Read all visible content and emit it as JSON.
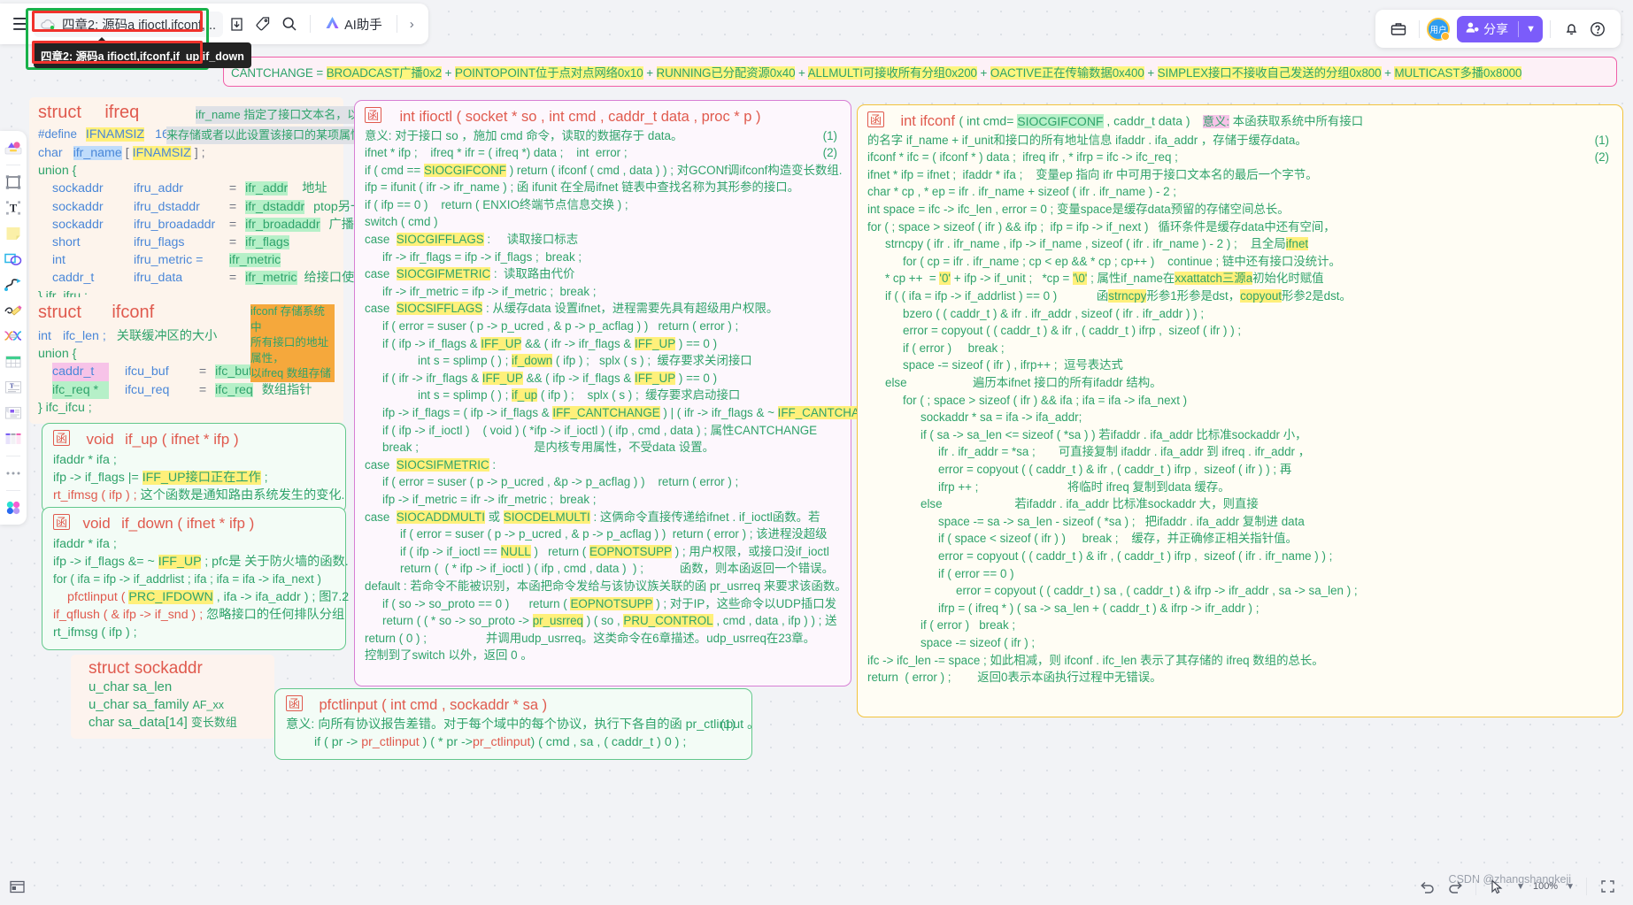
{
  "app": {
    "doc_title": "四章2: 源码a ifioctl,ifconf,...",
    "tooltip": "四章2: 源码a  ifioctl,ifconf,if_up,if_down",
    "ai_assistant": "AI助手",
    "share_label": "分享",
    "avatar_label": "用户",
    "zoom_level": "100%"
  },
  "toolbar_icons": [
    {
      "name": "menu-icon",
      "glyph": "≡"
    },
    {
      "name": "export-icon",
      "glyph": "⇩"
    },
    {
      "name": "tag-icon",
      "glyph": "🏷"
    },
    {
      "name": "search-icon",
      "glyph": "🔍"
    },
    {
      "name": "ai-icon",
      "glyph": "Ⓜ"
    },
    {
      "name": "expand-right-icon",
      "glyph": "›"
    }
  ],
  "topright_icons": [
    {
      "name": "briefcase-icon",
      "glyph": "🧰"
    },
    {
      "name": "bell-icon",
      "glyph": "🔔"
    },
    {
      "name": "help-icon",
      "glyph": "?"
    }
  ],
  "rail_items": [
    {
      "name": "shapes-tool"
    },
    {
      "name": "select-frame-tool"
    },
    {
      "name": "text-tool"
    },
    {
      "name": "sticky-note-tool"
    },
    {
      "name": "shape-tool"
    },
    {
      "name": "connector-tool"
    },
    {
      "name": "pen-tool"
    },
    {
      "name": "curve-tool"
    },
    {
      "name": "table-tool"
    },
    {
      "name": "text-card-tool"
    },
    {
      "name": "card-tool"
    },
    {
      "name": "kanban-tool"
    },
    {
      "name": "more-tools"
    },
    {
      "name": "color-palette-tool"
    }
  ],
  "banner": {
    "prefix": "CANTCHANGE = ",
    "items": [
      {
        "hl": "BROAD",
        "rest": "CAST广播0x2"
      },
      {
        "hl": "POINTO",
        "rest": "POINT位于点对点网络0x10"
      },
      {
        "hl": "RUNNING",
        "rest": "已分配资源0x40"
      },
      {
        "hl": "ALL",
        "rest": "MULTI可接收所有分组0x200"
      },
      {
        "hl": "O",
        "rest": "ACTIVE正在传输数据0x400"
      },
      {
        "hl": "",
        "rest": "SIMPLEX接口不接收自己发送的分组0x800"
      },
      {
        "hl": "MULTI",
        "rest": "CAST多播0x8000"
      }
    ]
  },
  "ifreq": {
    "title_kw": "struct",
    "title_name": "ifreq",
    "note1": "ifr_name 指定了接口文本名，以共用体",
    "note2": "来存储或者以此设置该接口的某项属性",
    "define_kw": "#define",
    "define_name": "IFNAMSIZ",
    "define_val": "16",
    "l_char": "char",
    "l_ifr_name": "ifr_name",
    "l_brk1": "[",
    "l_ifnamsiz": "IFNAMSIZ",
    "l_brk2": "] ;",
    "union_open": "union {",
    "members": [
      {
        "type": "sockaddr",
        "field": "ifru_addr",
        "eq": "=",
        "alias": "ifr_addr",
        "cmt": "地址"
      },
      {
        "type": "sockaddr",
        "field": "ifru_dstaddr",
        "eq": "=",
        "alias": "ifr_dstaddr",
        "cmt": "ptop另一端地址"
      },
      {
        "type": "sockaddr",
        "field": "ifru_broadaddr",
        "eq": "=",
        "alias": "ifr_broadaddr",
        "cmt": "广播地址"
      },
      {
        "type": "short",
        "field": "ifru_flags",
        "eq": "=",
        "alias": "ifr_flags",
        "cmt": ""
      },
      {
        "type": "int",
        "field": "ifru_metric =",
        "eq": "",
        "alias": "ifr_metric",
        "cmt": ""
      },
      {
        "type": "caddr_t",
        "field": "ifru_data",
        "eq": "=",
        "alias": "ifr_metric",
        "cmt": "给接口使用"
      }
    ],
    "union_close": "} ifr_ifru ;"
  },
  "ifconf_struct": {
    "title_kw": "struct",
    "title_name": "ifconf",
    "note": [
      "ifconf 存储系统中",
      "所有接口的地址属性，",
      "以ifreq 数组存储"
    ],
    "line_int": "int",
    "line_iclen": "ifc_len ;",
    "line_cmt": "关联缓冲区的大小",
    "union_open": "union {",
    "members": [
      {
        "type": "caddr_t",
        "field": "ifcu_buf",
        "eq": "=",
        "alias": "ifc_buf",
        "cmt": ""
      },
      {
        "type": "ifc_req *",
        "field": "ifcu_req",
        "eq": "=",
        "alias": "ifc_req",
        "cmt": "数组指针"
      }
    ],
    "union_close": "}  ifc_ifcu ;"
  },
  "if_up": {
    "sig_ret": "void",
    "sig_name": "if_up ( ifnet * ifp )",
    "lines": [
      "ifaddr * ifa ;",
      "ifp -> if_flags |= ",
      "rt_ifmsg ( ifp ) ; 这个函数是通知路由系统发生的变化."
    ],
    "hl_flag": "IFF_UP接口正在工作",
    "semi": " ;"
  },
  "if_down": {
    "sig_ret": "void",
    "sig_name": "if_down ( ifnet * ifp )",
    "l1": "ifaddr * ifa ;",
    "l2a": "ifp -> if_flags &=  ~ ",
    "l2hl": "IFF_UP",
    "l2b": " ; pfc是 关于防火墙的函数.",
    "l3": "for ( ifa = ifp -> if_addrlist ; ifa ; ifa = ifa -> ifa_next )",
    "l4a": "pfctlinput ( ",
    "l4hl": "PRC_IFDOWN",
    "l4b": " , ifa -> ifa_addr ) ; 图7.2",
    "l5": "if_qflush ( & ifp -> if_snd ) ; 忽略接口的任何排队分组",
    "l6": "rt_ifmsg ( ifp ) ;"
  },
  "sockaddr": {
    "title": "struct sockaddr",
    "l1a": "u_char sa_len",
    "l2a": "u_char sa_family",
    "l2b": "AF_xx",
    "l3a": "char sa_data[14]",
    "l3b": "变长数组"
  },
  "ifioctl": {
    "sig": "int  ifioctl ( socket * so , int cmd , caddr_t  data , proc * p )",
    "lines": [
      {
        "t": "意义: 对于接口 so ，施加 cmd 命令，读取的数据存于 data。",
        "n": "(1)"
      },
      {
        "t": "ifnet * ifp ;    ifreq * ifr = ( ifreq *) data ;    int  error ;",
        "n": "(2)"
      },
      {
        "t": "if ( cmd == §SIOCGIFCONF§ ) return ( ifconf ( cmd , data ) ) ; 对GCONf调ifconf构造变长数组.",
        "n": ""
      },
      {
        "t": "ifp = ifunit ( ifr -> ifr_name ) ; 函 ifunit 在全局ifnet 链表中查找名称为其形参的接口。",
        "n": ""
      },
      {
        "t": "if ( ifp == 0 )    return ( ENXIO终端节点信息交换 ) ;",
        "n": ""
      },
      {
        "t": "switch ( cmd )",
        "n": ""
      },
      {
        "t": "case  §SIOCGIFFLAGS§ :     读取接口标志",
        "n": ""
      },
      {
        "t": "    ifr -> ifr_flags = ifp -> if_flags ;  break ;",
        "n": ""
      },
      {
        "t": "case  §SIOCGIFMETRIC§ :  读取路由代价",
        "n": ""
      },
      {
        "t": "    ifr -> ifr_metric = ifp -> if_metric ;  break ;",
        "n": ""
      },
      {
        "t": "case  §SIOCSIFFLAGS§ : 从缓存data 设置ifnet，进程需要先具有超级用户权限。",
        "n": ""
      },
      {
        "t": "    if ( error = suser ( p -> p_ucred , & p -> p_acflag ) )   return ( error ) ;",
        "n": ""
      },
      {
        "t": "    if ( ifp -> if_flags & §IFF_UP§ && ( ifr -> ifr_flags & §IFF_UP§ ) == 0 )",
        "n": ""
      },
      {
        "t": "            int s = splimp ( ) ; §if_down§ ( ifp ) ;   splx ( s ) ;  缓存要求关闭接口",
        "n": ""
      },
      {
        "t": "    if ( ifr -> ifr_flags & §IFF_UP§ && ( ifp -> if_flags & §IFF_UP§ ) == 0 )",
        "n": ""
      },
      {
        "t": "            int s = splimp ( ) ; §if_up§ ( ifp ) ;    splx ( s ) ;  缓存要求启动接口",
        "n": ""
      },
      {
        "t": "    ifp -> if_flags = ( ifp -> if_flags & §IFF_CANTCHANGE§ ) | ( ifr -> ifr_flags & ~ §IFF_CANTCHANGE§ ) ;",
        "n": ""
      },
      {
        "t": "    if ( ifp -> if_ioctl )    ( void ) ( *ifp -> if_ioctl ) ( ifp , cmd , data ) ; 属性CANTCHANGE",
        "n": ""
      },
      {
        "t": "    break ;                                   是内核专用属性，不受data 设置。",
        "n": ""
      },
      {
        "t": "case  §SIOCSIFMETRIC§ :",
        "n": ""
      },
      {
        "t": "    if ( error = suser ( p -> p_ucred , &p -> p_acflag ) )    return ( error ) ;",
        "n": ""
      },
      {
        "t": "    ifp -> if_metric = ifr -> ifr_metric ;  break ;",
        "n": ""
      },
      {
        "t": "case  §SIOCADDMULTI§ 或 §SIOCDELMULTI§ : 这俩命令直接传递给ifnet . if_ioctl函数。若",
        "n": ""
      },
      {
        "t": "        if ( error = suser ( p -> p_ucred , & p -> p_acflag ) )  return ( error ) ; 该进程没超级",
        "n": ""
      },
      {
        "t": "        if ( ifp -> if_ioctl == §NULL§ )   return ( §EOPNOTSUPP§ ) ; 用户权限，或接口没if_ioctl",
        "n": ""
      },
      {
        "t": "        return (  ( * ifp -> if_ioctl ) ( ifp , cmd , data )  ) ;           函数，则本函返回一个错误。",
        "n": ""
      },
      {
        "t": "default : 若命令不能被识别，本函把命令发给与该协议族关联的函 pr_usrreq 来要求该函数。",
        "n": ""
      },
      {
        "t": "    if ( so -> so_proto == 0 )      return ( §EOPNOTSUPP§ ) ; 对于IP，这些命令以UDP插口发",
        "n": ""
      },
      {
        "t": "    return ( ( * so -> so_proto -> §pr_usrreq§ ) ( so , §PRU_CONTROL§ , cmd , data , ifp ) ) ; 送",
        "n": ""
      },
      {
        "t": "return ( 0 ) ;                  并调用udp_usrreq。这类命令在6章描述。udp_usrreq在23章。",
        "n": ""
      },
      {
        "t": "控制到了switch 以外，返回 0 。",
        "n": ""
      }
    ]
  },
  "ifconf_fn": {
    "sig_a": "int  ifconf ",
    "sig_b": "( int  cmd= ",
    "sig_hl": "SIOCGIFCONF",
    "sig_c": " , caddr_t   data )",
    "sig_note_hl": "意义:",
    "sig_note": " 本函获取系统中所有接口",
    "lines": [
      {
        "t": "的名字 if_name + if_unit和接口的所有地址信息 ifaddr . ifa_addr ，存储于缓存data。",
        "n": "(1)"
      },
      {
        "t": "ifconf * ifc = ( ifconf * ) data ;  ifreq ifr , * ifrp = ifc -> ifc_req ;",
        "n": "(2)"
      },
      {
        "t": "ifnet * ifp = ifnet ;  ifaddr * ifa ;    变量ep 指向 ifr 中可用于接口文本名的最后一个字节。",
        "n": ""
      },
      {
        "t": "char * cp , * ep = ifr . ifr_name + sizeof ( ifr . ifr_name ) - 2 ;",
        "n": ""
      },
      {
        "t": "int space = ifc -> ifc_len , error = 0 ; 变量space是缓存data预留的存储空间总长。",
        "n": ""
      },
      {
        "t": "for ( ; space > sizeof ( ifr ) && ifp ;  ifp = ifp -> if_next )   循环条件是缓存data中还有空间，",
        "n": ""
      },
      {
        "t": "    strncpy ( ifr . ifr_name , ifp -> if_name , sizeof ( ifr . ifr_name ) - 2 ) ;    且全局§ifnet§",
        "n": ""
      },
      {
        "t": "        for ( cp = ifr . ifr_name ; cp < ep && * cp ; cp++ )    continue ; 链中还有接口没统计。",
        "n": ""
      },
      {
        "t": "    * cp ++  = §'0'§ + ifp -> if_unit ;   *cp = §'\\0'§ ; 属性if_name在§xxattatch§§三源a§初始化时赋值",
        "n": ""
      },
      {
        "t": "    if ( ( ifa = ifp -> if_addrlist ) == 0 )            函§strncpy§形参1形参是dst，§copyout§形参2是dst。",
        "n": ""
      },
      {
        "t": "        bzero ( ( caddr_t ) & ifr . ifr_addr , sizeof ( ifr . ifr_addr ) ) ;",
        "n": ""
      },
      {
        "t": "        error = copyout ( ( caddr_t ) & ifr , ( caddr_t ) ifrp ,  sizeof ( ifr ) ) ;",
        "n": ""
      },
      {
        "t": "        if ( error )     break ;",
        "n": ""
      },
      {
        "t": "        space -= sizeof ( ifr ) , ifrp++ ;  逗号表达式",
        "n": ""
      },
      {
        "t": "    else                    遍历本ifnet 接口的所有ifaddr 结构。",
        "n": ""
      },
      {
        "t": "        for ( ; space > sizeof ( ifr ) && ifa ; ifa = ifa -> ifa_next )",
        "n": ""
      },
      {
        "t": "            sockaddr * sa = ifa -> ifa_addr;",
        "n": ""
      },
      {
        "t": "            if ( sa -> sa_len <= sizeof ( *sa ) ) 若ifaddr . ifa_addr 比标准sockaddr 小，",
        "n": ""
      },
      {
        "t": "                ifr . ifr_addr = *sa ;       可直接复制 ifaddr . ifa_addr 到 ifreq . ifr_addr ，",
        "n": ""
      },
      {
        "t": "                error = copyout ( ( caddr_t ) & ifr , ( caddr_t ) ifrp ,  sizeof ( ifr ) ) ; 再",
        "n": ""
      },
      {
        "t": "                ifrp ++ ;                           将临时 ifreq 复制到data 缓存。",
        "n": ""
      },
      {
        "t": "            else                      若ifaddr . ifa_addr 比标准sockaddr 大，则直接",
        "n": ""
      },
      {
        "t": "                space -= sa -> sa_len - sizeof ( *sa ) ;   把ifaddr . ifa_addr 复制进 data",
        "n": ""
      },
      {
        "t": "                if ( space < sizeof ( ifr ) )     break ;    缓存，并正确修正相关指针值。",
        "n": ""
      },
      {
        "t": "                error = copyout ( ( caddr_t ) & ifr , ( caddr_t ) ifrp ,  sizeof ( ifr . ifr_name ) ) ;",
        "n": ""
      },
      {
        "t": "                if ( error == 0 )",
        "n": ""
      },
      {
        "t": "                    error = copyout ( ( caddr_t ) sa , ( caddr_t ) & ifrp -> ifr_addr , sa -> sa_len ) ;",
        "n": ""
      },
      {
        "t": "                ifrp = ( ifreq * ) ( sa -> sa_len + ( caddr_t ) & ifrp -> ifr_addr ) ;",
        "n": ""
      },
      {
        "t": "            if ( error )   break ;",
        "n": ""
      },
      {
        "t": "            space -= sizeof ( ifr ) ;",
        "n": ""
      },
      {
        "t": "ifc -> ifc_len -= space ; 如此相减，则 ifconf . ifc_len 表示了其存储的 ifreq 数组的总长。",
        "n": ""
      },
      {
        "t": "return  ( error ) ;        返回0表示本函执行过程中无错误。",
        "n": ""
      }
    ]
  },
  "pfctlinput": {
    "sig": "pfctlinput ( int  cmd ,  sockaddr * sa )",
    "l1a": "意义: 向所有协议报告差错。对于每个域中的每个协议，执行下各自的函 pr_ctlinput 。",
    "l1n": "(1)",
    "l2": "if ( pr -> pr_ctlinput ) ( * pr ->pr_ctlinput ) ( cmd , sa , ( caddr_t ) 0 ) ;"
  },
  "watermark": "CSDN @zhangshangkeji",
  "colors": {
    "accent_purple": "#7b5cfa",
    "banner_border": "#f05fa8",
    "green_box": "#63c88c",
    "purple_box": "#d77fd4",
    "orange_box": "#f2c33c"
  }
}
